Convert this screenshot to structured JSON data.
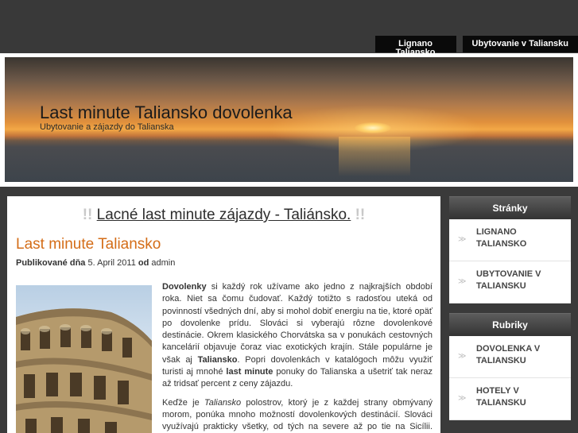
{
  "topnav": {
    "items": [
      {
        "label": "Lignano Taliansko"
      },
      {
        "label": "Ubytovanie v Taliansku"
      }
    ]
  },
  "header": {
    "title": "Last minute Taliansko dovolenka",
    "subtitle": "Ubytovanie a zájazdy do Talianska"
  },
  "main": {
    "banner_bang_left": "!!",
    "banner_link": "Lacné last minute zájazdy - Taliánsko.",
    "banner_bang_right": "!!",
    "post_title": "Last minute Taliansko",
    "meta_published_label": "Publikované dňa",
    "meta_date": "5. April 2011",
    "meta_by_label": "od",
    "meta_author": "admin",
    "p1": {
      "b1": "Dovolenky",
      "t1": " si každý rok užívame ako jedno z najkrajších období roka. Niet sa čomu čudovať. Každý totižto s radosťou uteká od povinností všedných dní, aby si mohol dobiť energiu na tie, ktoré opäť po dovolenke prídu. Slováci si vyberajú rôzne dovolenkové destinácie. Okrem klasického Chorvátska sa v ponukách cestovných kancelárií objavuje čoraz viac exotických krajín. Stále populárne je však aj ",
      "b2": "Taliansko",
      "t2": ". Popri dovolenkách v katalógoch môžu využiť turisti aj mnohé ",
      "b3": "last minute",
      "t3": " ponuky do Talianska a ušetriť tak neraz až tridsať percent z ceny zájazdu."
    },
    "p2": {
      "t1": "Keďže je ",
      "i1": "Taliansko",
      "t2": " polostrov, ktorý je z každej strany obmývaný morom, ponúka mnoho možností dovolenkových destinácií. Slováci využívajú prakticky všetky, od tých na severe až po tie na Sicílii. Severné letoviská, akými sú napríklad Bibione, ale aj Palmová Riviéra"
    }
  },
  "sidebar": {
    "pages_title": "Stránky",
    "pages": [
      {
        "label": "LIGNANO TALIANSKO"
      },
      {
        "label": "UBYTOVANIE V TALIANSKU"
      }
    ],
    "categories_title": "Rubriky",
    "categories": [
      {
        "label": "DOVOLENKA V TALIANSKU"
      },
      {
        "label": "HOTELY V TALIANSKU"
      }
    ],
    "arrow_glyph": "≫"
  }
}
